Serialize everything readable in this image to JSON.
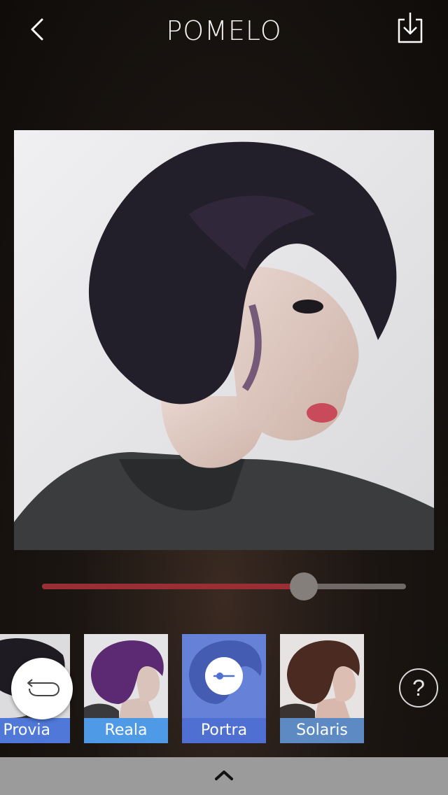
{
  "header": {
    "title": "POMELO",
    "back_icon": "chevron-left-icon",
    "save_icon": "download-icon"
  },
  "editor": {
    "intensity": 0.72,
    "colors": {
      "slider_fill": "#9a2e35",
      "slider_track": "#6e6966",
      "slider_thumb": "#857f7c"
    }
  },
  "filters": [
    {
      "name": "Provia",
      "color": "#4f78d8"
    },
    {
      "name": "Reala",
      "color": "#4e9ae7"
    },
    {
      "name": "Portra",
      "color": "#4f6fd3",
      "selected": true
    },
    {
      "name": "Solaris",
      "color": "#5d8ac3"
    }
  ],
  "controls": {
    "undo_icon": "undo-icon",
    "help_label": "?",
    "expand_icon": "chevron-up-icon"
  }
}
